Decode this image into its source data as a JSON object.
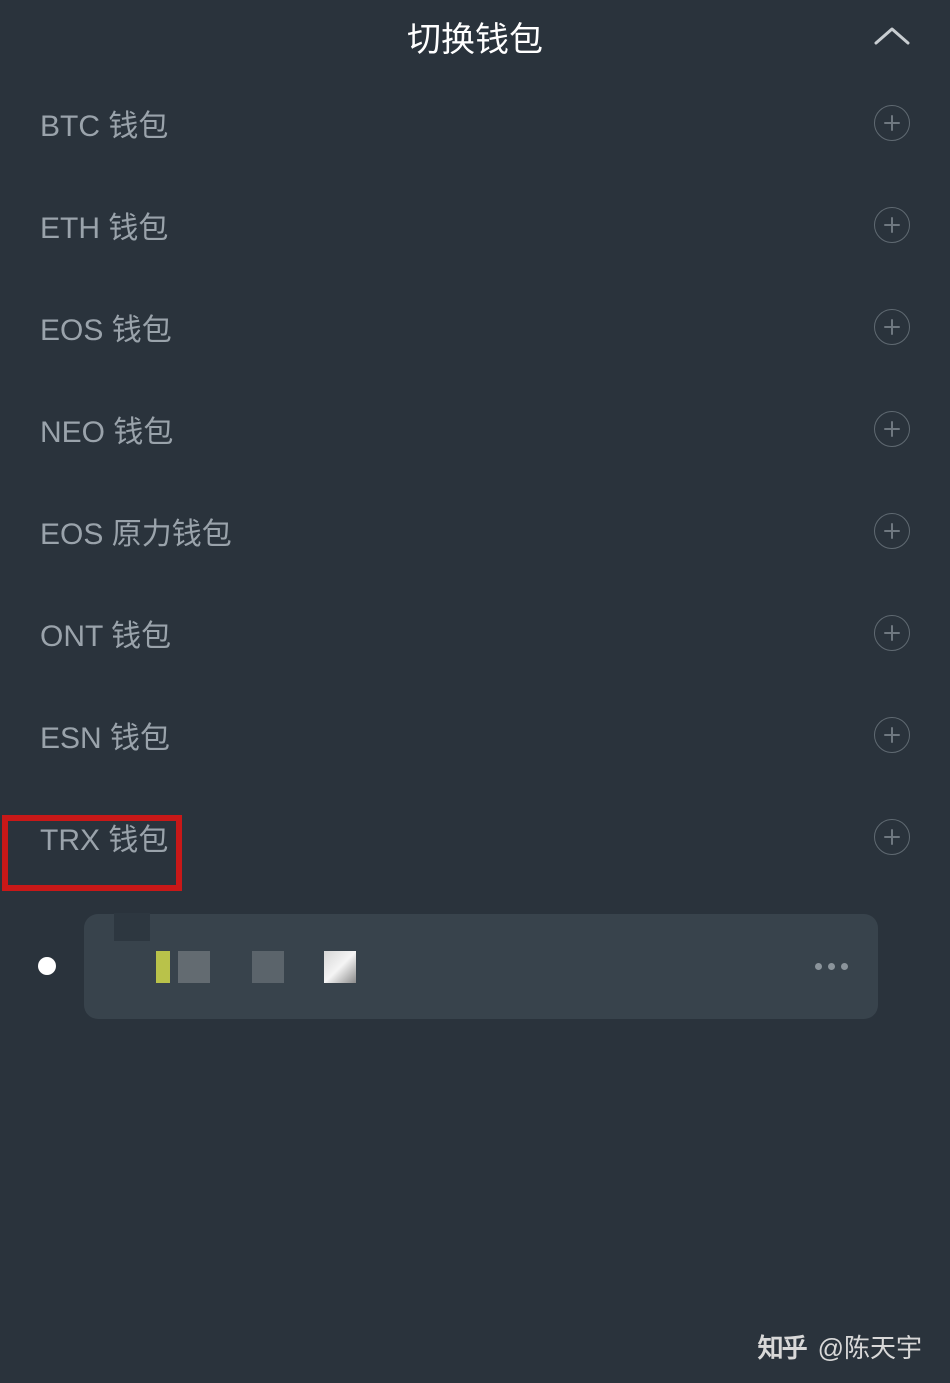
{
  "header": {
    "title": "切换钱包"
  },
  "wallets": [
    {
      "label": "BTC 钱包"
    },
    {
      "label": "ETH 钱包"
    },
    {
      "label": "EOS 钱包"
    },
    {
      "label": "NEO 钱包"
    },
    {
      "label": "EOS 原力钱包"
    },
    {
      "label": "ONT 钱包"
    },
    {
      "label": "ESN 钱包"
    },
    {
      "label": "TRX 钱包"
    }
  ],
  "highlight": {
    "target_index": 7
  },
  "watermark": {
    "platform": "知乎",
    "author_prefix": "@",
    "author": "陈天宇"
  }
}
